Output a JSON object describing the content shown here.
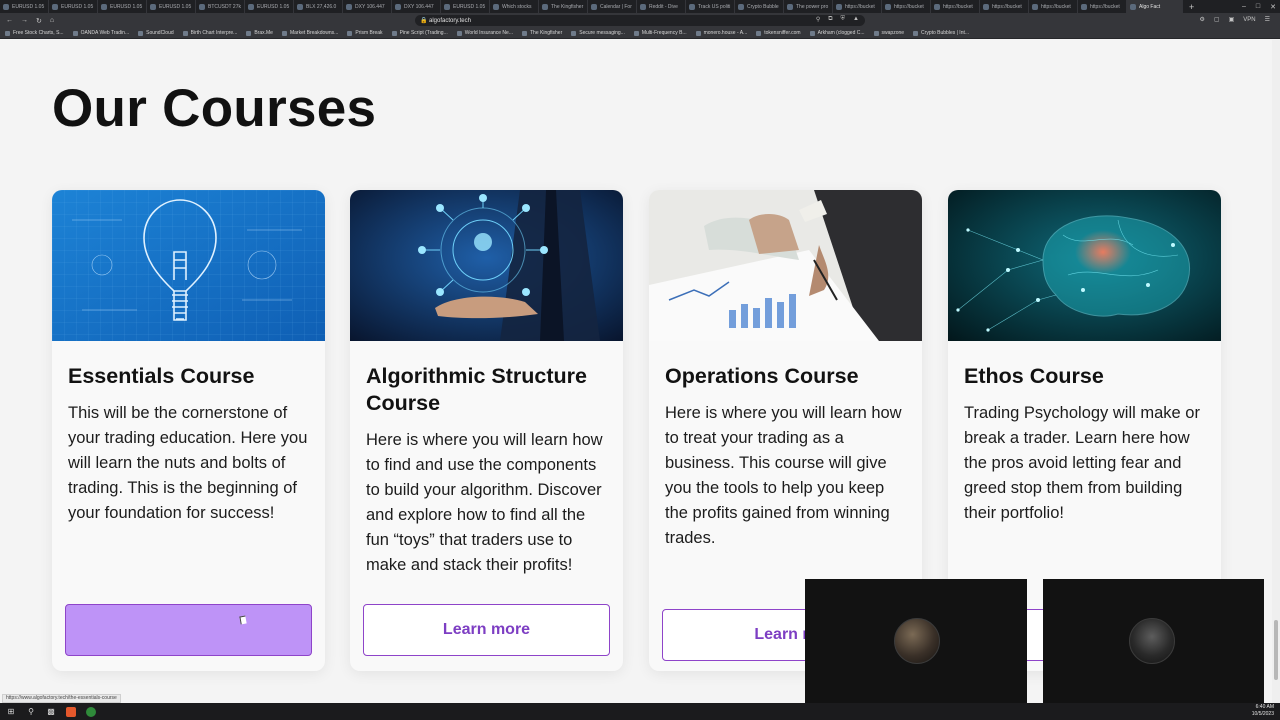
{
  "browser": {
    "tabs": [
      {
        "label": "EURUSD 1.05",
        "active": false
      },
      {
        "label": "EURUSD 1.05",
        "active": false
      },
      {
        "label": "EURUSD 1.05",
        "active": false
      },
      {
        "label": "EURUSD 1.05",
        "active": false
      },
      {
        "label": "BTCUSDT 27k",
        "active": false
      },
      {
        "label": "EURUSD 1.05",
        "active": false
      },
      {
        "label": "BLX 27,426.0",
        "active": false
      },
      {
        "label": "DXY 106.447",
        "active": false
      },
      {
        "label": "DXY 106.447",
        "active": false
      },
      {
        "label": "EURUSD 1.05",
        "active": false
      },
      {
        "label": "Which stocks",
        "active": false
      },
      {
        "label": "The Kingfisher",
        "active": false
      },
      {
        "label": "Calendar | For",
        "active": false
      },
      {
        "label": "Reddit - Dive",
        "active": false
      },
      {
        "label": "Track US politi",
        "active": false
      },
      {
        "label": "Crypto Bubble",
        "active": false
      },
      {
        "label": "The power pro",
        "active": false
      },
      {
        "label": "https://bucket",
        "active": false
      },
      {
        "label": "https://bucket",
        "active": false
      },
      {
        "label": "https://bucket",
        "active": false
      },
      {
        "label": "https://bucket",
        "active": false
      },
      {
        "label": "https://bucket",
        "active": false
      },
      {
        "label": "https://bucket",
        "active": false
      },
      {
        "label": "Algo Fact",
        "active": true
      }
    ],
    "new_tab": "+",
    "address": "algofactory.tech",
    "vpn": "VPN",
    "bookmarks": [
      "Free Stock Charts, S...",
      "OANDA Web Tradin...",
      "SoundCloud",
      "Birth Chart Interpre...",
      "Brax.Me",
      "Market Breakdowns...",
      "Prism Break",
      "Pine Script (Trading...",
      "World Insurance Ne...",
      "The Kingfisher",
      "Secure messaging...",
      "Multi-Frequency B...",
      "monero.house - A...",
      "tokensniffer.com",
      "Arkham (clogged C...",
      "swapzone",
      "Crypto Bubbles | Int..."
    ]
  },
  "page": {
    "title": "Our Courses",
    "courses": [
      {
        "title": "Essentials Course",
        "description": "This will be the cornerstone of your trading education. Here you will learn the nuts and bolts of trading. This is the beginning of your foundation for success!",
        "button": "",
        "image": "lightbulb-blueprint"
      },
      {
        "title": "Algorithmic Structure Course",
        "description": "Here is where you will learn how to find and use the components to build your algorithm. Discover and explore how to find all the fun “toys” that traders use to make and stack their profits!",
        "button": "Learn more",
        "image": "tech-hand-network"
      },
      {
        "title": "Operations Course",
        "description": "Here is where you will learn how to treat your trading as a business. This course will give you the tools to help you keep the profits gained from winning trades.",
        "button": "Learn m",
        "image": "business-charts-desk"
      },
      {
        "title": "Ethos Course",
        "description": "Trading Psychology will make or break a trader.  Learn here how the pros avoid letting fear and greed stop them from building their portfolio!",
        "button": "",
        "image": "neural-brain"
      }
    ]
  },
  "status_bar": {
    "url": "https://www.algofactory.tech/the-essentials-course"
  },
  "taskbar": {
    "time": "6:40 AM",
    "date": "10/5/2023"
  },
  "colors": {
    "accent": "#8e44c9",
    "button_hover": "#be93f7",
    "page_bg": "#f4f4f4"
  }
}
